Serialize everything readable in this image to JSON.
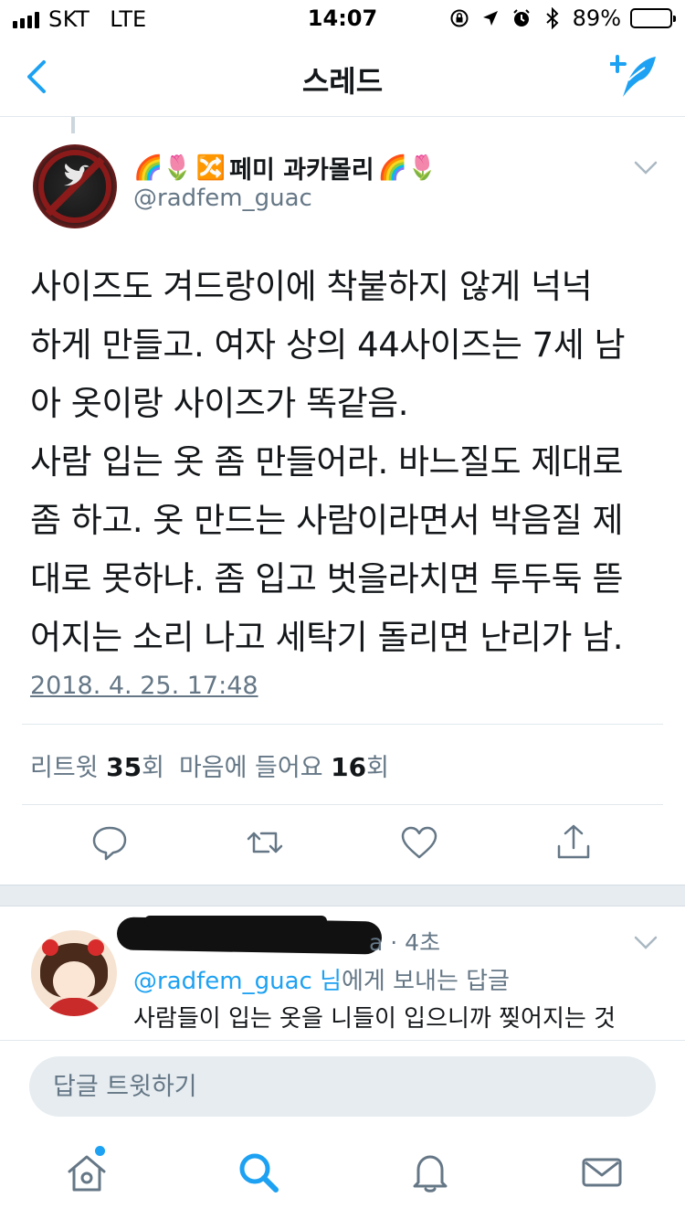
{
  "status_bar": {
    "carrier": "SKT",
    "network": "LTE",
    "time": "14:07",
    "battery_percent": "89%",
    "battery_level": 0.89,
    "icons": [
      "screen-lock-icon",
      "location-arrow-icon",
      "alarm-icon",
      "bluetooth-icon"
    ]
  },
  "nav": {
    "title": "스레드",
    "back_icon": "chevron-left-icon",
    "compose_icon": "compose-tweet-icon"
  },
  "tweet": {
    "author_name_prefix_emoji": "🌈🌷",
    "author_name_shuffle": "🔀",
    "author_name": "페미 과카몰리",
    "author_name_suffix_emoji": "🌈🌷",
    "handle": "@radfem_guac",
    "text": "사이즈도 겨드랑이에 착붙하지 않게 넉넉\n하게 만들고. 여자 상의 44사이즈는 7세 남\n아 옷이랑 사이즈가 똑같음.\n사람 입는 옷 좀 만들어라. 바느질도 제대로\n좀 하고. 옷 만드는 사람이라면서 박음질 제\n대로 못하냐. 좀 입고 벗을라치면 투두둑 뜯\n어지는 소리 나고 세탁기 돌리면 난리가 남.",
    "date": "2018. 4. 25. 17:48",
    "retweet_label": "리트윗",
    "retweet_count": "35",
    "count_suffix": "회",
    "like_label": "마음에 들어요",
    "like_count": "16"
  },
  "reply": {
    "time": "a · 4초",
    "to_mention": "@radfem_guac",
    "to_suffix_nim": " 님",
    "to_suffix": "에게 보내는 답글",
    "text": "사람들이 입는 옷을 니들이 입으니까 찢어지는 것"
  },
  "composer": {
    "placeholder": "답글 트윗하기"
  },
  "tabs": [
    "home-icon",
    "search-icon",
    "notifications-icon",
    "messages-icon"
  ],
  "colors": {
    "accent": "#1da1f2",
    "muted": "#657786",
    "text": "#14171a",
    "battery": "#f5c400"
  }
}
